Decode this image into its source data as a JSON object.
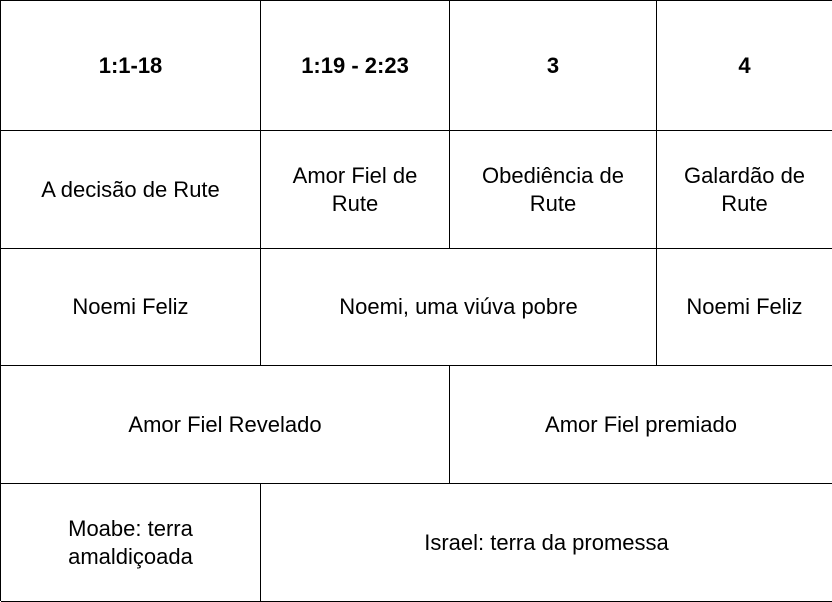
{
  "rows": {
    "chapters": [
      "1:1-18",
      "1:19 - 2:23",
      "3",
      "4"
    ],
    "ruth": [
      "A decisão de Rute",
      "Amor Fiel de Rute",
      "Obediência de Rute",
      "Galardão de Rute"
    ],
    "naomi": [
      "Noemi Feliz",
      "Noemi, uma viúva pobre",
      "Noemi Feliz"
    ],
    "love": [
      "Amor Fiel Revelado",
      "Amor Fiel premiado"
    ],
    "land": [
      "Moabe: terra amaldiçoada",
      "Israel: terra da promessa"
    ]
  }
}
